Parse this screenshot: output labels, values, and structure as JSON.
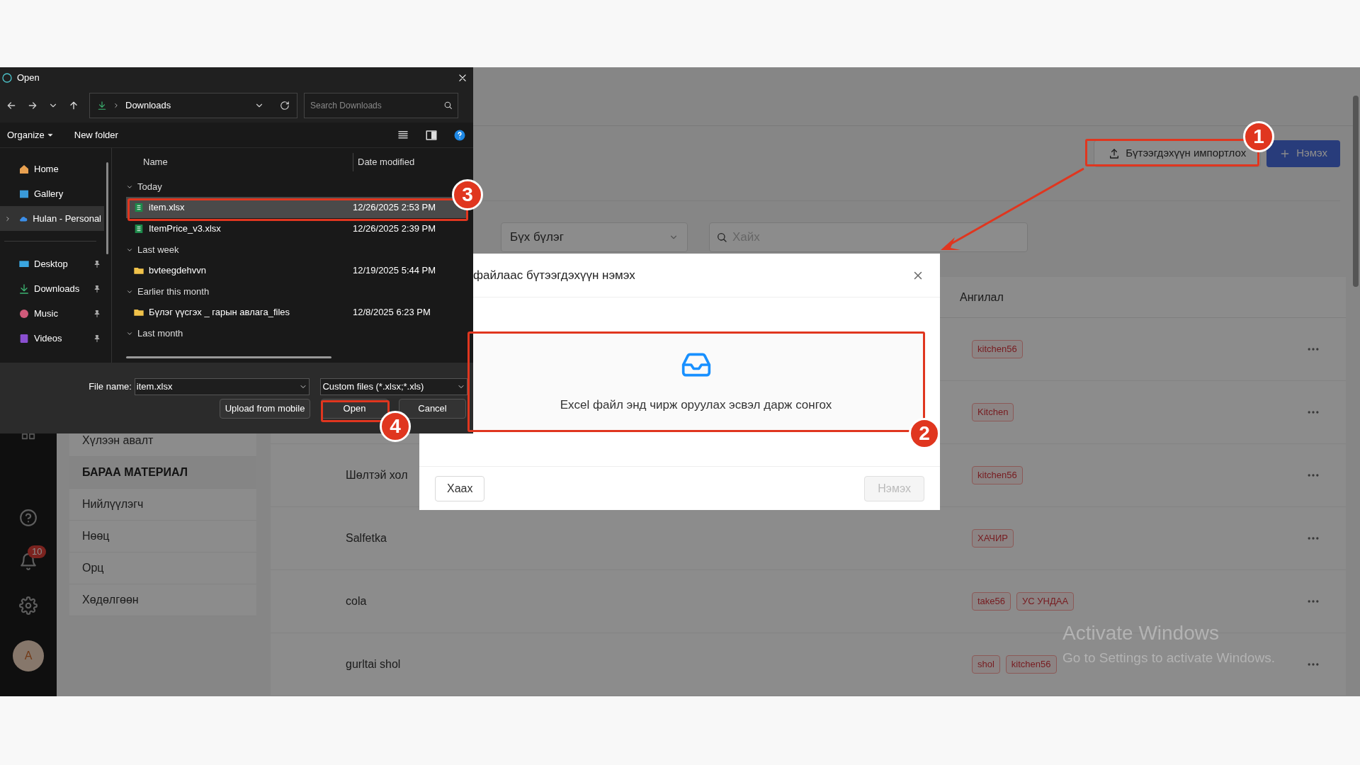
{
  "app": {
    "sidebar": {
      "notification_count": "10",
      "avatar": "A"
    },
    "submenu": [
      {
        "label": "Хүлээн авалт",
        "kind": "item"
      },
      {
        "label": "БАРАА МАТЕРИАЛ",
        "kind": "header"
      },
      {
        "label": "Нийлүүлэгч",
        "kind": "item"
      },
      {
        "label": "Нөөц",
        "kind": "item"
      },
      {
        "label": "Орц",
        "kind": "item"
      },
      {
        "label": "Хөдөлгөөн",
        "kind": "item"
      }
    ],
    "toolbar": {
      "import_button": "Бүтээгдэхүүн импортлох",
      "add_button": "Нэмэх"
    },
    "filters": {
      "group_select": "Бүх бүлэг",
      "search": {
        "placeholder": "Хайх"
      }
    },
    "table": {
      "columns": [
        {
          "label": "Ангилал"
        }
      ],
      "rows": [
        {
          "tags": [
            "kitchen56"
          ]
        },
        {
          "tags": [
            "Kitchen"
          ]
        },
        {
          "name": "Шөлтэй хол",
          "tags": [
            "kitchen56"
          ]
        },
        {
          "name": "Salfetka",
          "tags": [
            "ХАЧИР"
          ]
        },
        {
          "name": "cola",
          "tags": [
            "take56",
            "УС УНДАА"
          ]
        },
        {
          "name": "gurltai shol",
          "tags": [
            "shol",
            "kitchen56"
          ]
        }
      ]
    }
  },
  "modal": {
    "title": "файлаас бүтээгдэхүүн нэмэх",
    "dropzone_text": "Excel файл энд чирж оруулах эсвэл дарж сонгох",
    "cancel_button": "Хаах",
    "submit_button": {
      "label": "Нэмэх",
      "disabled": true
    }
  },
  "file_dialog": {
    "title": "Open",
    "path": "Downloads",
    "search": {
      "placeholder": "Search Downloads"
    },
    "toolbar": [
      "Organize",
      "New folder"
    ],
    "nav_items": [
      {
        "label": "Home",
        "kind": "home",
        "pinned": false,
        "selected": false
      },
      {
        "label": "Gallery",
        "kind": "gallery",
        "pinned": false,
        "selected": false
      },
      {
        "label": "Hulan - Personal",
        "kind": "cloud",
        "pinned": false,
        "selected": true
      },
      {
        "label": "Desktop",
        "kind": "desktop",
        "pinned": true,
        "selected": false
      },
      {
        "label": "Downloads",
        "kind": "downloads",
        "pinned": true,
        "selected": false
      },
      {
        "label": "Music",
        "kind": "music",
        "pinned": true,
        "selected": false
      },
      {
        "label": "Videos",
        "kind": "videos",
        "pinned": true,
        "selected": false
      }
    ],
    "columns": [
      "Name",
      "Date modified"
    ],
    "groups": [
      {
        "label": "Today",
        "files": [
          {
            "name": "item.xlsx",
            "date": "12/26/2025 2:53 PM",
            "kind": "excel",
            "selected": true
          },
          {
            "name": "ItemPrice_v3.xlsx",
            "date": "12/26/2025 2:39 PM",
            "kind": "excel",
            "selected": false
          }
        ]
      },
      {
        "label": "Last week",
        "files": [
          {
            "name": "bvteegdehvvn",
            "date": "12/19/2025 5:44 PM",
            "kind": "folder",
            "selected": false
          }
        ]
      },
      {
        "label": "Earlier this month",
        "files": [
          {
            "name": "Бүлэг үүсгэх _ гарын авлага_files",
            "date": "12/8/2025 6:23 PM",
            "kind": "folder",
            "selected": false
          }
        ]
      },
      {
        "label": "Last month"
      }
    ],
    "file_name_label": "File name:",
    "file_name": "item.xlsx",
    "file_type": "Custom files (*.xlsx;*.xls)",
    "buttons": [
      "Upload from mobile",
      "Open",
      "Cancel"
    ]
  },
  "annotations": [
    {
      "number": "1"
    },
    {
      "number": "2"
    },
    {
      "number": "3"
    },
    {
      "number": "4"
    }
  ],
  "watermark": [
    "Activate Windows",
    "Go to Settings to activate Windows."
  ]
}
